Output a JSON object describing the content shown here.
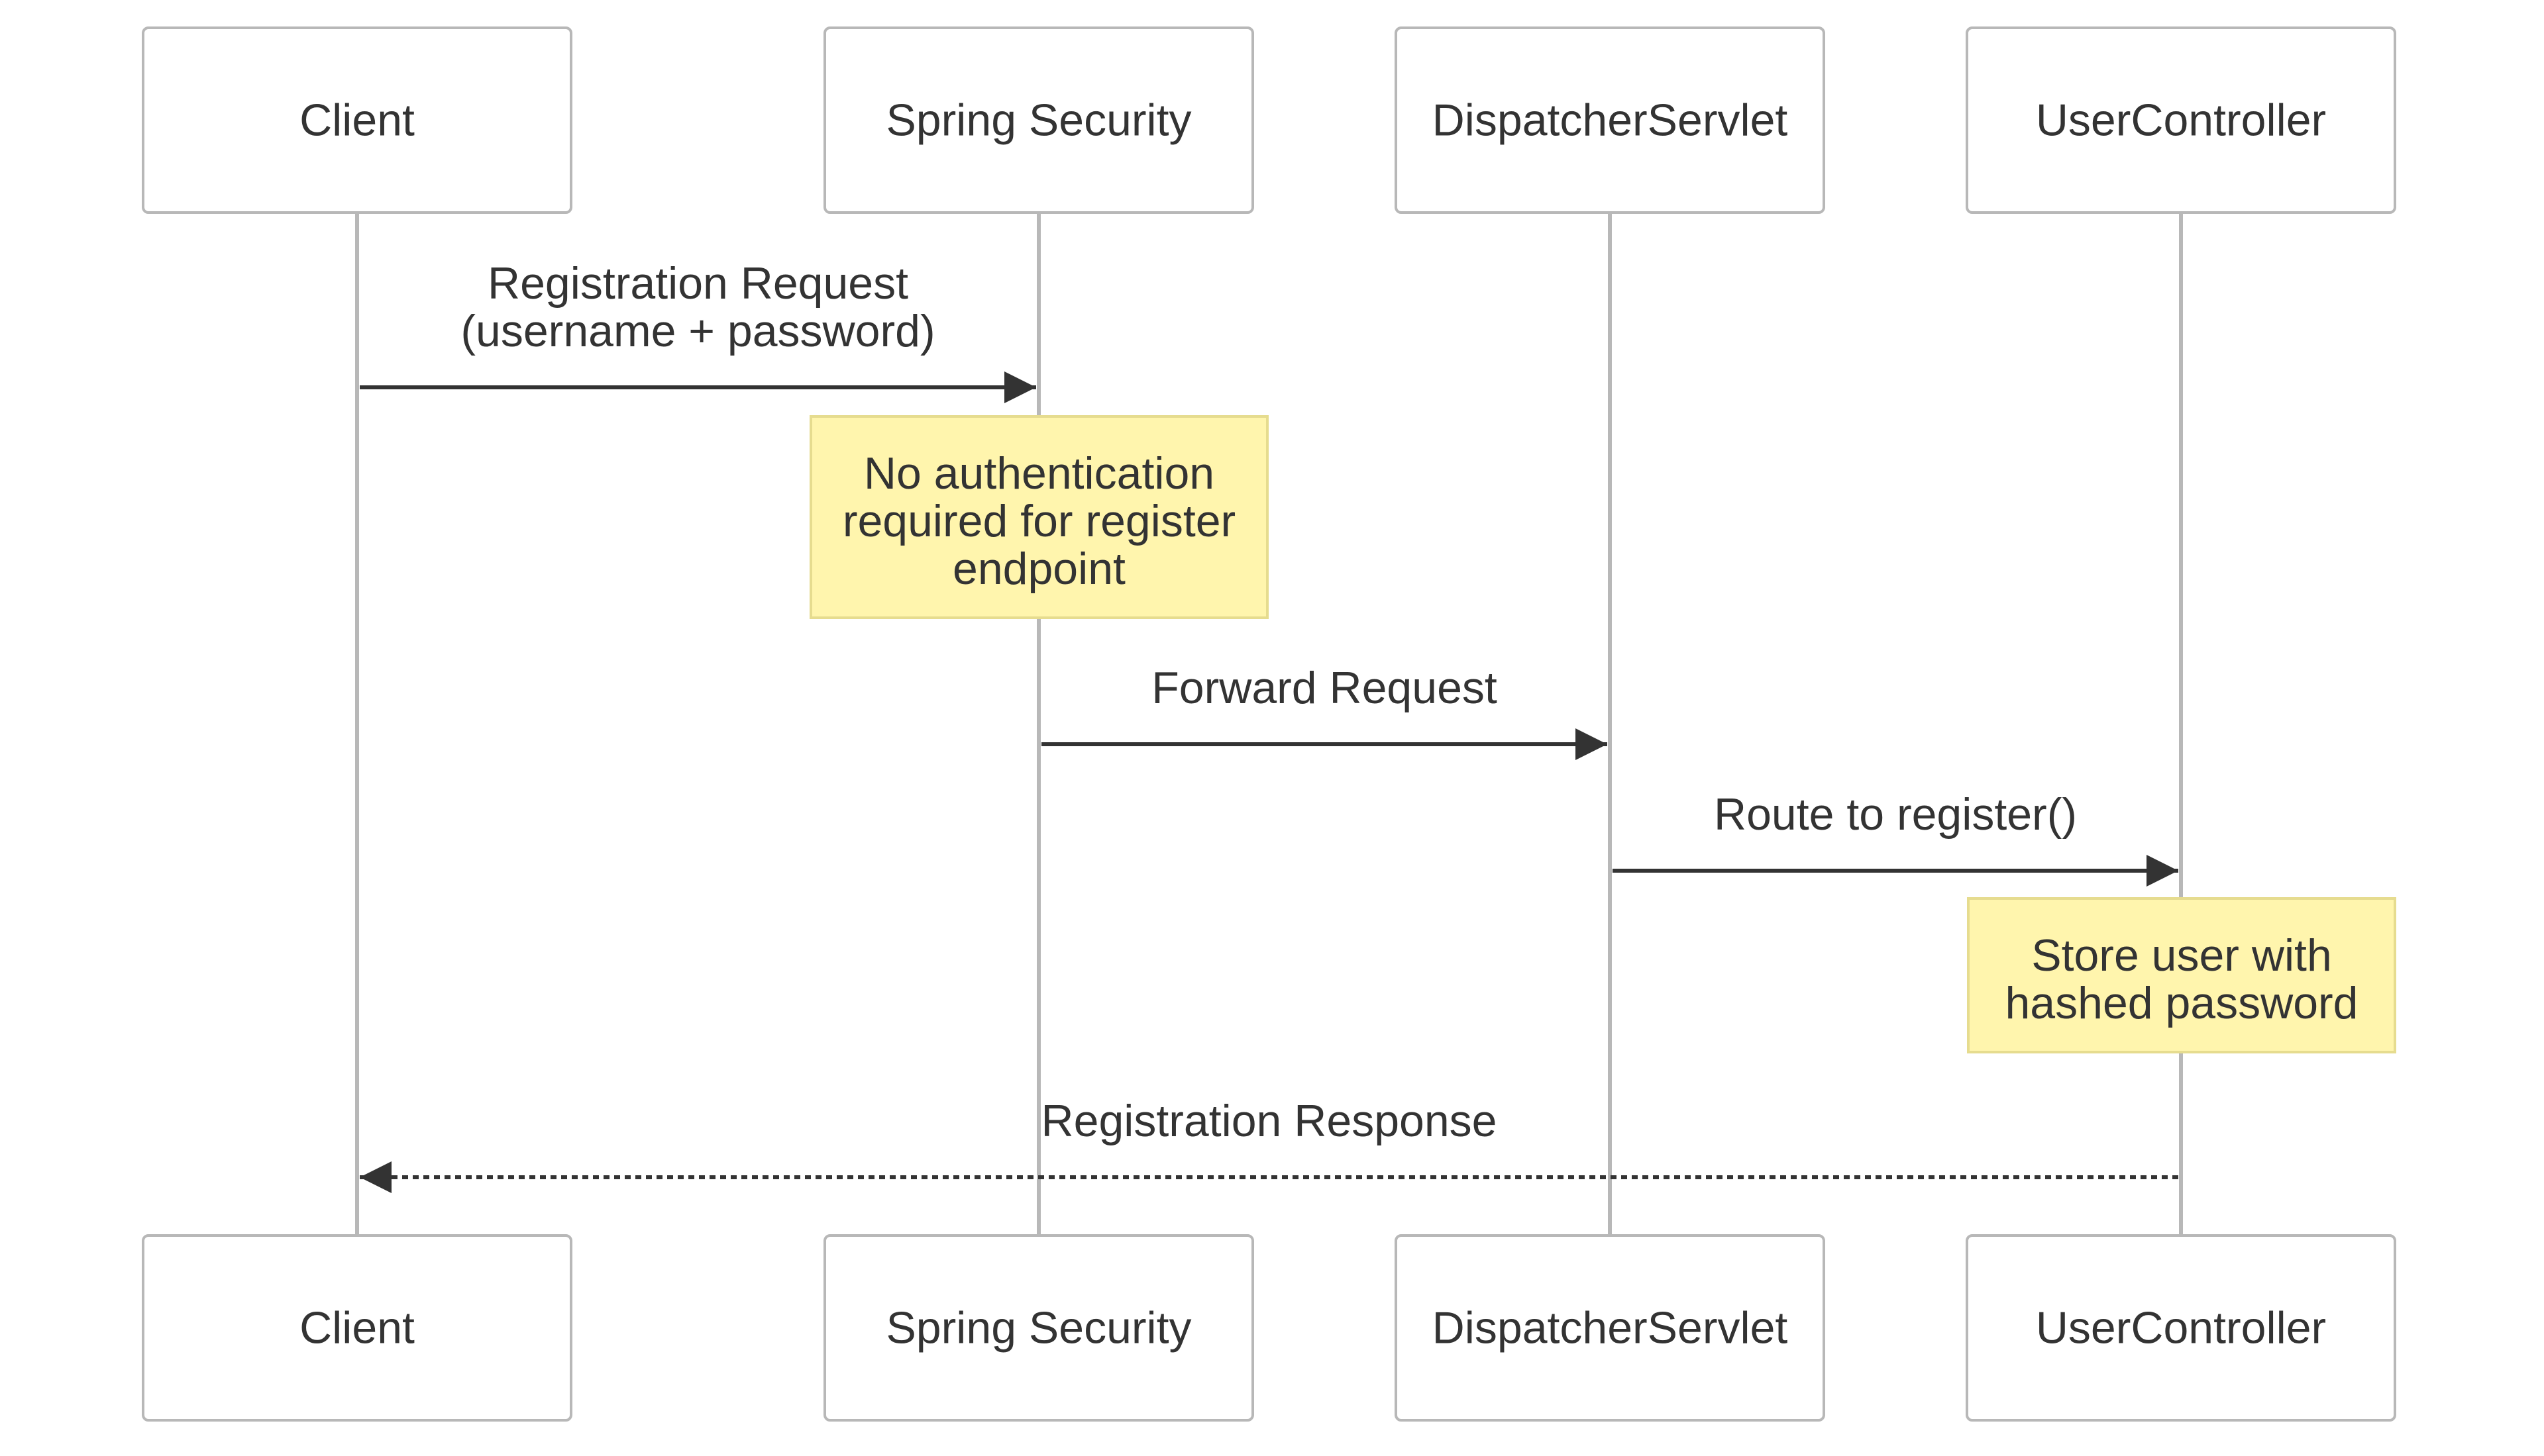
{
  "diagram": {
    "type": "sequence",
    "participants": [
      "Client",
      "Spring Security",
      "DispatcherServlet",
      "UserController"
    ],
    "messages": [
      {
        "from": 0,
        "to": 1,
        "style": "solid",
        "lines": [
          "Registration Request",
          "(username + password)"
        ]
      },
      {
        "from": 1,
        "to": 2,
        "style": "solid",
        "lines": [
          "Forward Request"
        ]
      },
      {
        "from": 2,
        "to": 3,
        "style": "solid",
        "lines": [
          "Route to register()"
        ]
      },
      {
        "from": 3,
        "to": 0,
        "style": "dashed",
        "lines": [
          "Registration Response"
        ]
      }
    ],
    "notes": [
      {
        "over": 1,
        "after_message": 0,
        "lines": [
          "No authentication",
          "required for register",
          "endpoint"
        ]
      },
      {
        "over": 3,
        "after_message": 2,
        "lines": [
          "Store user with",
          "hashed password"
        ]
      }
    ]
  },
  "colors": {
    "actor_border": "#b8b8b8",
    "actor_fill": "#ffffff",
    "lifeline": "#b8b8b8",
    "arrow": "#333333",
    "text": "#333333",
    "note_fill": "#fff5ad",
    "note_border": "#e6dc8f"
  }
}
